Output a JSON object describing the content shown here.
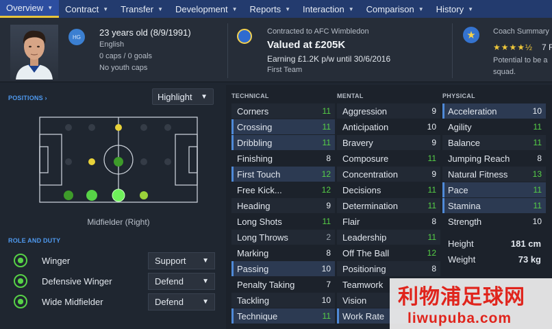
{
  "nav": {
    "tabs": [
      {
        "label": "Overview"
      },
      {
        "label": "Contract"
      },
      {
        "label": "Transfer"
      },
      {
        "label": "Development"
      },
      {
        "label": "Reports"
      },
      {
        "label": "Interaction"
      },
      {
        "label": "Comparison"
      },
      {
        "label": "History"
      }
    ],
    "active": "Overview"
  },
  "header": {
    "badge": "HG",
    "age": "23 years old (8/9/1991)",
    "nationality": "English",
    "caps": "0 caps / 0 goals",
    "youth_caps": "No youth caps",
    "contract": "Contracted to AFC Wimbledon",
    "value": "Valued at £205K",
    "earning": "Earning £1.2K p/w until 30/6/2016",
    "squad_status": "First Team",
    "coach_title": "Coach Summary",
    "coach_stars": "★★★★½",
    "coach_extra": "7 F",
    "coach_text_1": "Potential to be a",
    "coach_text_2": "squad."
  },
  "positions": {
    "label": "POSITIONS",
    "highlight": "Highlight",
    "position_text": "Midfielder (Right)"
  },
  "roles": {
    "label": "ROLE AND DUTY",
    "items": [
      {
        "name": "Winger",
        "duty": "Support"
      },
      {
        "name": "Defensive Winger",
        "duty": "Defend"
      },
      {
        "name": "Wide Midfielder",
        "duty": "Defend"
      }
    ]
  },
  "attributes": {
    "technical": {
      "heading": "TECHNICAL",
      "items": [
        {
          "name": "Corners",
          "value": "11",
          "tone": "green",
          "hl": false
        },
        {
          "name": "Crossing",
          "value": "11",
          "tone": "green",
          "hl": true
        },
        {
          "name": "Dribbling",
          "value": "11",
          "tone": "green",
          "hl": true
        },
        {
          "name": "Finishing",
          "value": "8",
          "tone": "white",
          "hl": false
        },
        {
          "name": "First Touch",
          "value": "12",
          "tone": "green",
          "hl": true
        },
        {
          "name": "Free Kick...",
          "value": "12",
          "tone": "green",
          "hl": false
        },
        {
          "name": "Heading",
          "value": "9",
          "tone": "white",
          "hl": false
        },
        {
          "name": "Long Shots",
          "value": "11",
          "tone": "green",
          "hl": false
        },
        {
          "name": "Long Throws",
          "value": "2",
          "tone": "grey",
          "hl": false
        },
        {
          "name": "Marking",
          "value": "8",
          "tone": "white",
          "hl": false
        },
        {
          "name": "Passing",
          "value": "10",
          "tone": "white",
          "hl": true
        },
        {
          "name": "Penalty Taking",
          "value": "7",
          "tone": "white",
          "hl": false
        },
        {
          "name": "Tackling",
          "value": "10",
          "tone": "white",
          "hl": false
        },
        {
          "name": "Technique",
          "value": "11",
          "tone": "green",
          "hl": true
        }
      ]
    },
    "mental": {
      "heading": "MENTAL",
      "items": [
        {
          "name": "Aggression",
          "value": "9",
          "tone": "white",
          "hl": false
        },
        {
          "name": "Anticipation",
          "value": "10",
          "tone": "white",
          "hl": false
        },
        {
          "name": "Bravery",
          "value": "9",
          "tone": "white",
          "hl": false
        },
        {
          "name": "Composure",
          "value": "11",
          "tone": "green",
          "hl": false
        },
        {
          "name": "Concentration",
          "value": "9",
          "tone": "white",
          "hl": false
        },
        {
          "name": "Decisions",
          "value": "11",
          "tone": "green",
          "hl": false
        },
        {
          "name": "Determination",
          "value": "11",
          "tone": "green",
          "hl": false
        },
        {
          "name": "Flair",
          "value": "8",
          "tone": "white",
          "hl": false
        },
        {
          "name": "Leadership",
          "value": "11",
          "tone": "green",
          "hl": false
        },
        {
          "name": "Off The Ball",
          "value": "12",
          "tone": "green",
          "hl": false
        },
        {
          "name": "Positioning",
          "value": "8",
          "tone": "white",
          "hl": false
        },
        {
          "name": "Teamwork",
          "value": "",
          "tone": "white",
          "hl": false
        },
        {
          "name": "Vision",
          "value": "",
          "tone": "white",
          "hl": false
        },
        {
          "name": "Work Rate",
          "value": "",
          "tone": "white",
          "hl": true
        }
      ]
    },
    "physical": {
      "heading": "PHYSICAL",
      "items": [
        {
          "name": "Acceleration",
          "value": "10",
          "tone": "white",
          "hl": true
        },
        {
          "name": "Agility",
          "value": "11",
          "tone": "green",
          "hl": false
        },
        {
          "name": "Balance",
          "value": "11",
          "tone": "green",
          "hl": false
        },
        {
          "name": "Jumping Reach",
          "value": "8",
          "tone": "white",
          "hl": false
        },
        {
          "name": "Natural Fitness",
          "value": "13",
          "tone": "green",
          "hl": false
        },
        {
          "name": "Pace",
          "value": "11",
          "tone": "green",
          "hl": true
        },
        {
          "name": "Stamina",
          "value": "11",
          "tone": "green",
          "hl": true
        },
        {
          "name": "Strength",
          "value": "10",
          "tone": "white",
          "hl": false
        }
      ],
      "height_label": "Height",
      "height": "181 cm",
      "weight_label": "Weight",
      "weight": "73 kg"
    }
  },
  "watermark": {
    "cn": "利物浦足球网",
    "url": "liwupuba.com"
  },
  "colors": {
    "nav_bg": "#233b6e",
    "nav_active": "#2d4ea0",
    "accent_yellow": "#e9c53a",
    "green": "#57d247",
    "link_blue": "#4f9af0"
  }
}
